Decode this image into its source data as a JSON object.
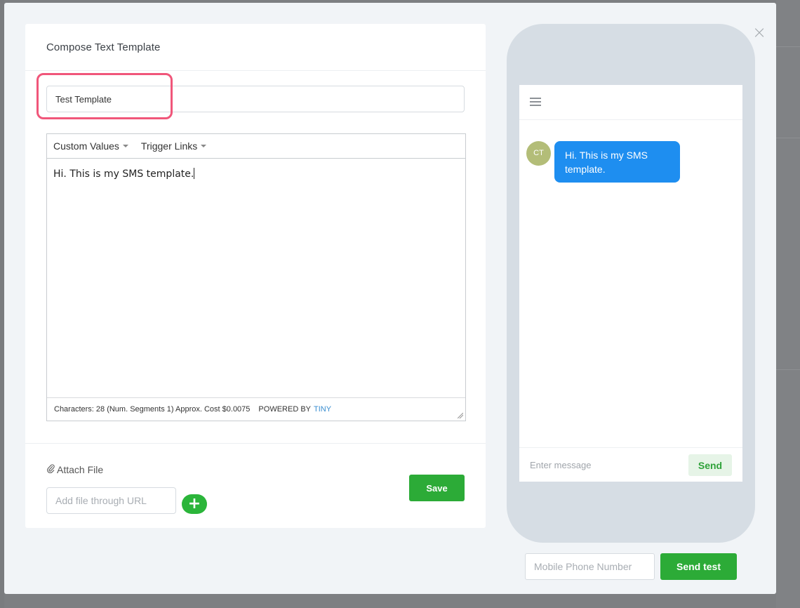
{
  "modal": {
    "title": "Compose Text Template",
    "close_glyph": "×"
  },
  "template": {
    "name_value": "Test Template",
    "toolbar": {
      "custom_values_label": "Custom Values",
      "trigger_links_label": "Trigger Links"
    },
    "body_text": "Hi. This is my SMS template.",
    "status": {
      "characters_text": "Characters: 28 (Num. Segments 1) Approx. Cost $0.0075",
      "powered_by_label": "POWERED BY",
      "tiny_label": "TINY"
    }
  },
  "attachment": {
    "label": "Attach File",
    "url_placeholder": "Add file through URL",
    "add_glyph": "+"
  },
  "save_label": "Save",
  "preview": {
    "avatar_initials": "CT",
    "message_text": "Hi. This is my SMS template.",
    "message_input_placeholder": "Enter message",
    "send_label": "Send"
  },
  "test": {
    "phone_placeholder": "Mobile Phone Number",
    "send_test_label": "Send test"
  },
  "colors": {
    "accent_green": "#2cab37",
    "bubble_blue": "#1e8ef0",
    "highlight_pink": "#f0567a"
  }
}
